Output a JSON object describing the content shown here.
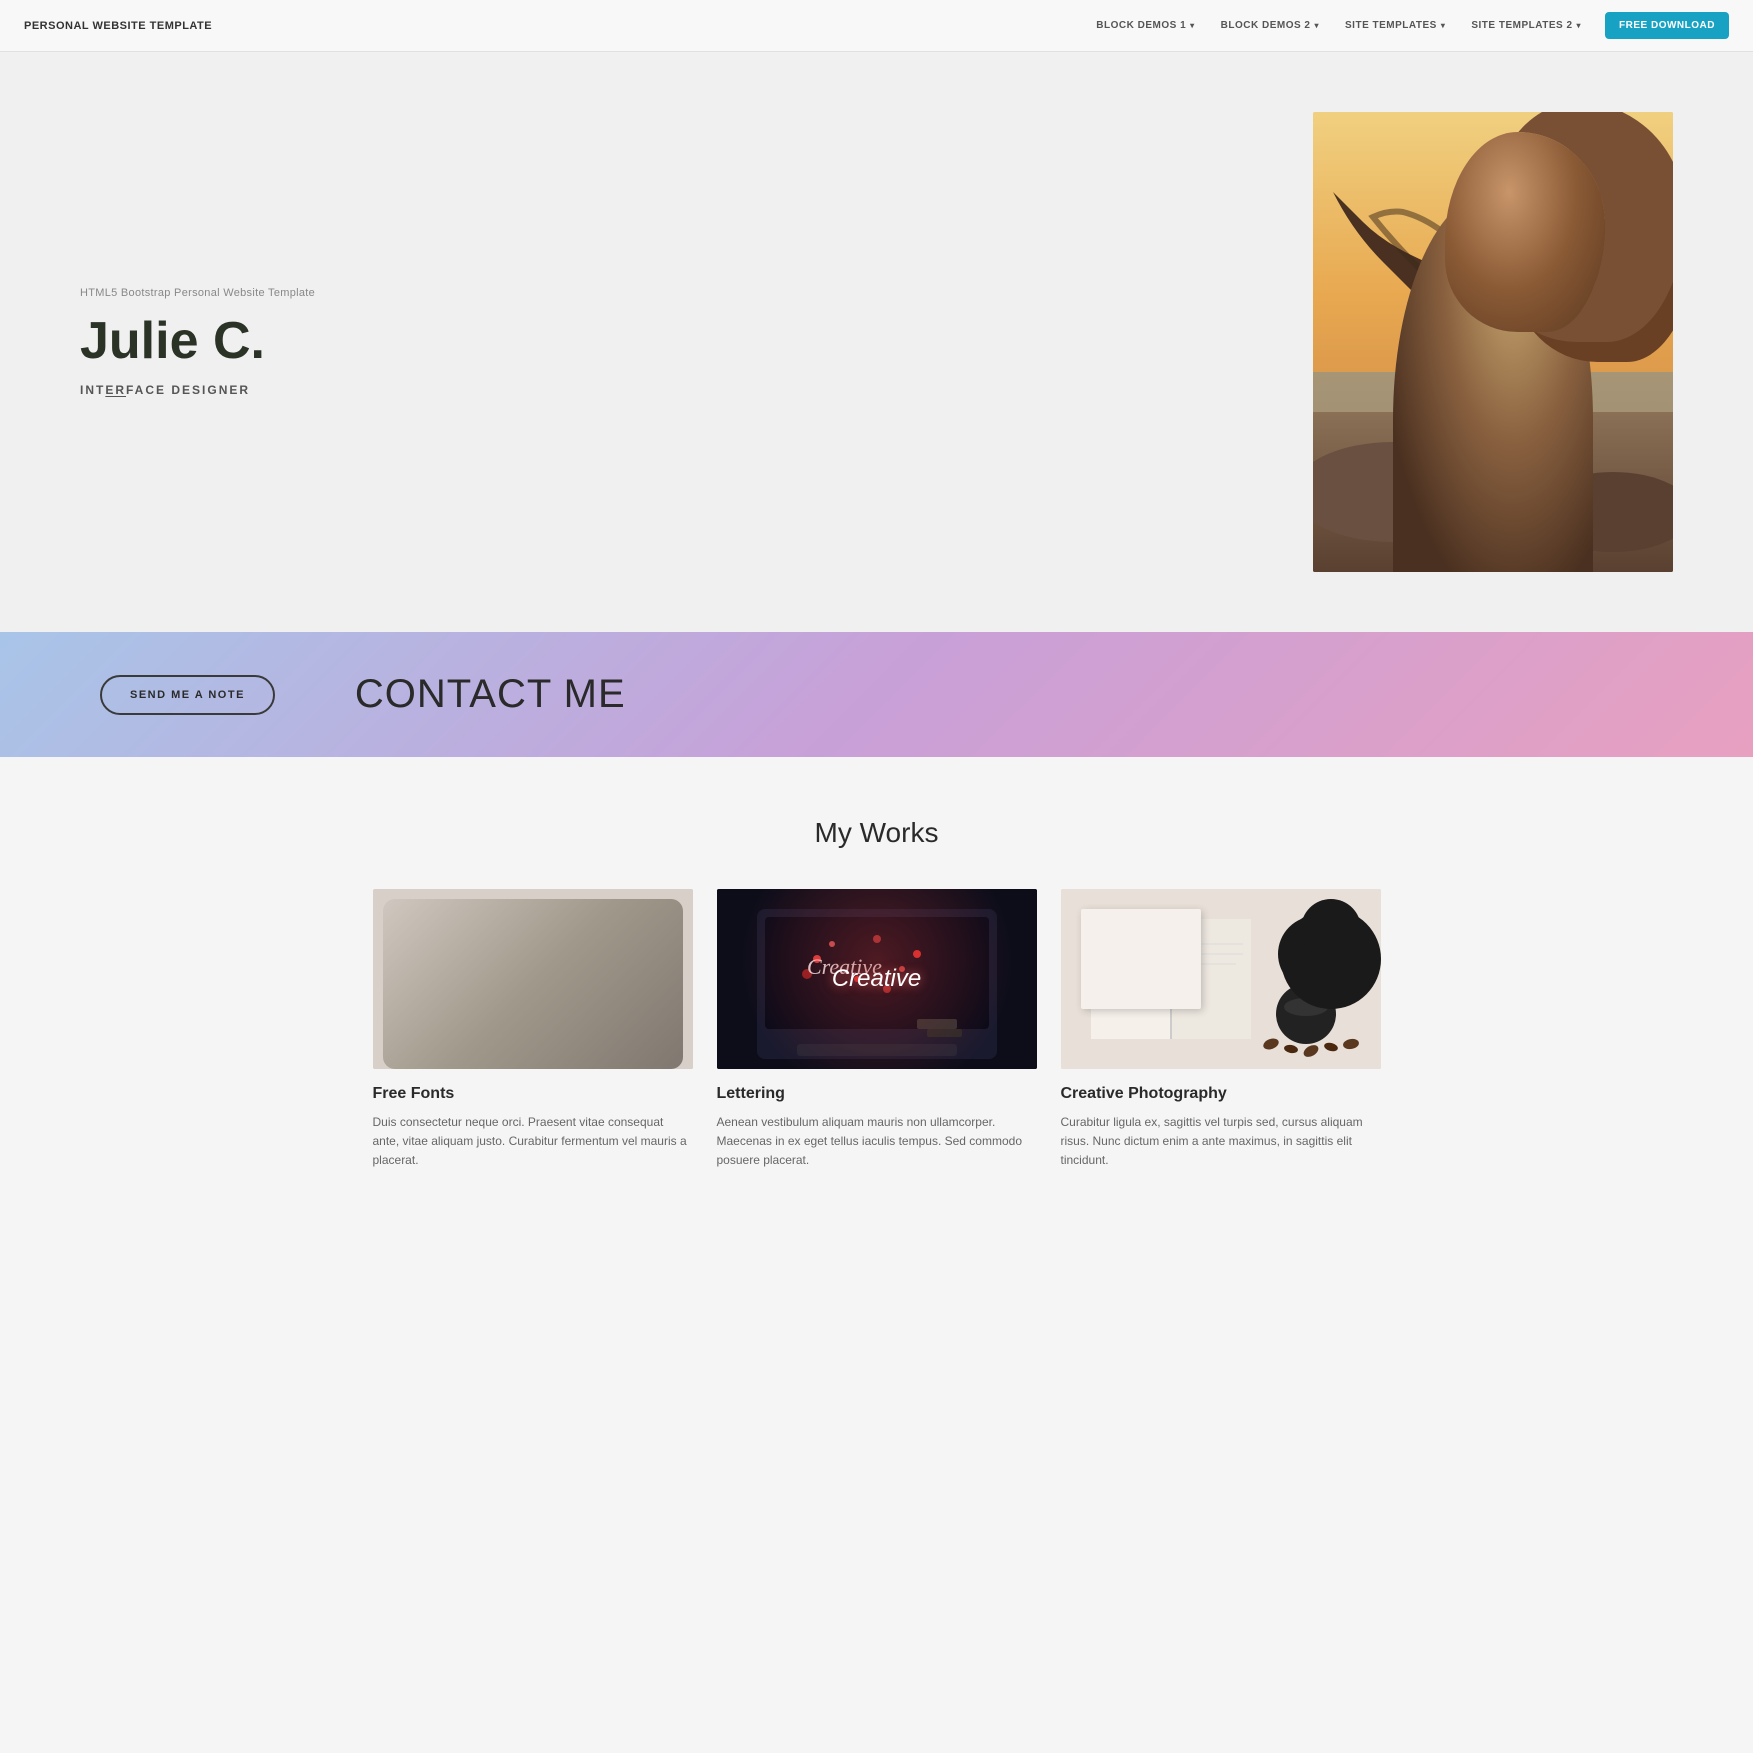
{
  "navbar": {
    "brand": "PERSONAL WEBSITE TEMPLATE",
    "links": [
      {
        "label": "BLOCK DEMOS 1",
        "has_dropdown": true
      },
      {
        "label": "BLOCK DEMOS 2",
        "has_dropdown": true
      },
      {
        "label": "SITE TEMPLATES",
        "has_dropdown": true
      },
      {
        "label": "SITE TEMPLATES 2",
        "has_dropdown": true
      }
    ],
    "cta_label": "FREE DOWNLOAD"
  },
  "hero": {
    "subtitle": "HTML5 Bootstrap Personal Website Template",
    "name": "Julie C.",
    "role_prefix": "INT",
    "role_underline": "ER",
    "role_suffix": "FACE DESIGNER"
  },
  "contact_band": {
    "button_label": "SEND ME A NOTE",
    "title": "CONTACT ME"
  },
  "works": {
    "section_title": "My Works",
    "cards": [
      {
        "title": "Free Fonts",
        "description": "Duis consectetur neque orci. Praesent vitae consequat ante, vitae aliquam justo. Curabitur fermentum vel mauris a placerat."
      },
      {
        "title": "Lettering",
        "description": "Aenean vestibulum aliquam mauris non ullamcorper. Maecenas in ex eget tellus iaculis tempus. Sed commodo posuere placerat."
      },
      {
        "title": "Creative Photography",
        "description": "Curabitur ligula ex, sagittis vel turpis sed, cursus aliquam risus. Nunc dictum enim a ante maximus, in sagittis elit tincidunt."
      }
    ]
  }
}
